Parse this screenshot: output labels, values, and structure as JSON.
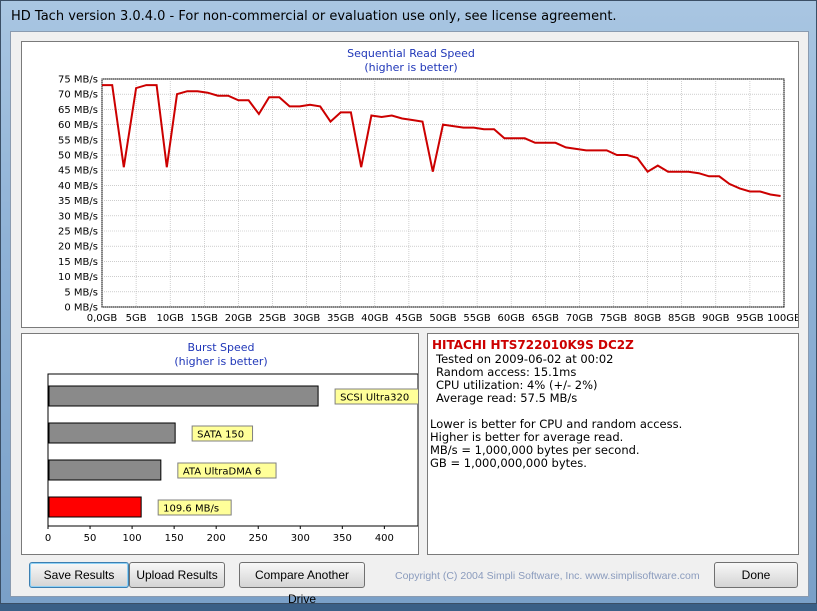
{
  "window": {
    "title": "HD Tach version 3.0.4.0  - For non-commercial or evaluation use only, see license agreement."
  },
  "read_chart": {
    "title": "Sequential Read Speed",
    "subtitle": "(higher is better)"
  },
  "burst_chart": {
    "title": "Burst Speed",
    "subtitle": "(higher is better)"
  },
  "info": {
    "drive_name": "HITACHI HTS722010K9S DC2Z",
    "tested_on": "Tested on 2009-06-02 at 00:02",
    "random_access": "Random access: 15.1ms",
    "cpu_utilization": "CPU utilization: 4% (+/- 2%)",
    "average_read": "Average read: 57.5 MB/s",
    "note1": "Lower is better for CPU and random access.",
    "note2": "Higher is better for average read.",
    "note3": "MB/s = 1,000,000 bytes per second.",
    "note4": "GB = 1,000,000,000 bytes."
  },
  "buttons": {
    "save": "Save Results",
    "upload": "Upload Results",
    "compare": "Compare Another Drive",
    "done": "Done"
  },
  "copyright": "Copyright (C) 2004 Simpli Software, Inc. www.simplisoftware.com",
  "chart_data": [
    {
      "type": "line",
      "title": "Sequential Read Speed",
      "subtitle": "(higher is better)",
      "color": "#cc0000",
      "y_ticks": [
        "0 MB/s",
        "5 MB/s",
        "10 MB/s",
        "15 MB/s",
        "20 MB/s",
        "25 MB/s",
        "30 MB/s",
        "35 MB/s",
        "40 MB/s",
        "45 MB/s",
        "50 MB/s",
        "55 MB/s",
        "60 MB/s",
        "65 MB/s",
        "70 MB/s",
        "75 MB/s"
      ],
      "x_ticks": [
        "0,0GB",
        "5GB",
        "10GB",
        "15GB",
        "20GB",
        "25GB",
        "30GB",
        "35GB",
        "40GB",
        "45GB",
        "50GB",
        "55GB",
        "60GB",
        "65GB",
        "70GB",
        "75GB",
        "80GB",
        "85GB",
        "90GB",
        "95GB",
        "100GB"
      ],
      "xlim": [
        0,
        100
      ],
      "ylim": [
        0,
        75
      ],
      "grid": true,
      "x": [
        0,
        1.5,
        3.2,
        5,
        6.5,
        8,
        9.5,
        11,
        12.5,
        14,
        15.5,
        17,
        18.5,
        20,
        21.5,
        23,
        24.5,
        26,
        27.5,
        29,
        30.5,
        32,
        33.5,
        35,
        36.5,
        38,
        39.5,
        41,
        42.5,
        44,
        45.5,
        47,
        48.5,
        50,
        51.5,
        53,
        54.5,
        56,
        57.5,
        59,
        60.5,
        62,
        63.5,
        65,
        66.5,
        68,
        69.5,
        71,
        72.5,
        74,
        75.5,
        77,
        78.5,
        80,
        81.5,
        83,
        84.5,
        86,
        87.5,
        89,
        90.5,
        92,
        93.5,
        95,
        96.5,
        98,
        99.5
      ],
      "y": [
        73,
        73,
        46,
        72,
        73,
        73,
        46,
        70,
        71,
        71,
        70.5,
        69.5,
        69.5,
        68,
        68,
        63.5,
        69,
        69,
        66,
        66,
        66.5,
        66,
        61,
        64,
        64,
        46,
        63,
        62.5,
        63,
        62,
        61.5,
        61,
        44.5,
        60,
        59.5,
        59,
        59,
        58.5,
        58.5,
        55.5,
        55.5,
        55.5,
        54,
        54,
        54,
        52.5,
        52,
        51.5,
        51.5,
        51.5,
        50,
        50,
        49,
        44.5,
        46.5,
        44.5,
        44.5,
        44.5,
        44,
        43,
        43,
        40.5,
        39,
        38,
        38,
        37,
        36.5
      ]
    },
    {
      "type": "bar",
      "title": "Burst Speed",
      "subtitle": "(higher is better)",
      "categories": [
        "SCSI Ultra320",
        "SATA 150",
        "ATA UltraDMA 6",
        "109.6 MB/s"
      ],
      "values": [
        320,
        150,
        133,
        109.6
      ],
      "colors": [
        "#8a8a8a",
        "#8a8a8a",
        "#8a8a8a",
        "#ff0000"
      ],
      "x_ticks": [
        "0",
        "50",
        "100",
        "150",
        "200",
        "250",
        "300",
        "350",
        "400"
      ],
      "xlim": [
        0,
        440
      ]
    }
  ]
}
